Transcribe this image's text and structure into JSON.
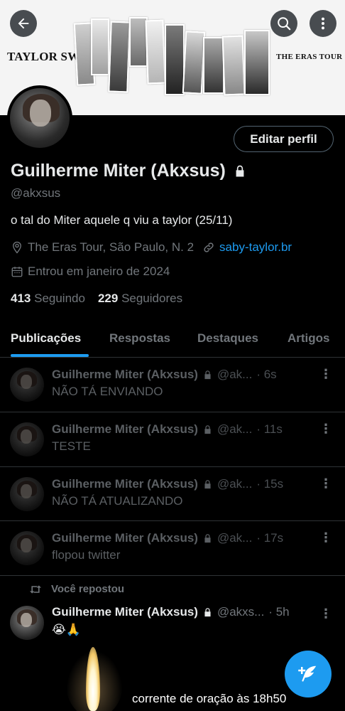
{
  "banner": {
    "left_text": "TAYLOR SWIFT",
    "right_text": "THE ERAS TOUR"
  },
  "profile": {
    "edit_button": "Editar perfil",
    "name": "Guilherme Miter (Akxsus)",
    "handle": "@akxsus",
    "bio": "o tal do Miter aquele q viu a taylor (25/11)",
    "location": "The Eras Tour, São Paulo, N. 2",
    "website": "saby-taylor.br",
    "joined": "Entrou em janeiro de 2024",
    "following_count": "413",
    "following_label": "Seguindo",
    "followers_count": "229",
    "followers_label": "Seguidores"
  },
  "tabs": [
    "Publicações",
    "Respostas",
    "Destaques",
    "Artigos"
  ],
  "posts": [
    {
      "name": "Guilherme Miter (Akxsus)",
      "handle": "@ak...",
      "time": "· 6s",
      "text": "NÃO TÁ ENVIANDO"
    },
    {
      "name": "Guilherme Miter (Akxsus)",
      "handle": "@ak...",
      "time": "· 11s",
      "text": "TESTE"
    },
    {
      "name": "Guilherme Miter (Akxsus)",
      "handle": "@ak...",
      "time": "· 15s",
      "text": "NÃO TÁ ATUALIZANDO"
    },
    {
      "name": "Guilherme Miter (Akxsus)",
      "handle": "@ak...",
      "time": "· 17s",
      "text": "flopou twitter"
    }
  ],
  "repost": {
    "label": "Você repostou",
    "name": "Guilherme Miter (Akxsus)",
    "handle": "@akxs...",
    "time": "· 5h",
    "text": "😭🙏",
    "media_caption": "corrente de oração às 18h50"
  },
  "colors": {
    "accent": "#1d9bf0",
    "background": "#000000",
    "secondary_text": "#71767b",
    "divider": "#2f3336"
  }
}
